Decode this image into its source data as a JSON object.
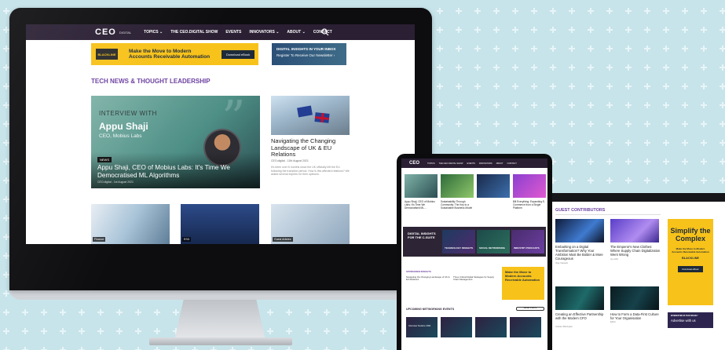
{
  "colors": {
    "background": "#c7e4ea",
    "nav_bg": "#2a1f33",
    "accent_purple": "#6b3fa0",
    "ad_yellow": "#f7c21a"
  },
  "desktop": {
    "nav": {
      "logo": "CEO",
      "logo_tag": "DIGITAL",
      "items": [
        "TOPICS ⌄",
        "THE CEO.DIGITAL SHOW",
        "EVENTS",
        "INNOVATORS ⌄",
        "ABOUT ⌄",
        "CONTACT"
      ],
      "search_icon": "search-icon"
    },
    "banner_blackline": {
      "logo": "BLACKLINE",
      "text": "Make the Move to Modern Accounts Receivable Automation",
      "button": "Download eBook"
    },
    "banner_digital": {
      "line1": "DIGITAL INSIGHTS IN YOUR INBOX",
      "line2": "Register To Receive Our Newsletter ›"
    },
    "section_title": "TECH NEWS & THOUGHT LEADERSHIP",
    "feature": {
      "kicker": "INTERVIEW WITH",
      "name": "Appu Shaji",
      "role": "CEO, Mobius Labs",
      "tag": "NEWS",
      "title": "Appu Shaji, CEO of Mobius Labs: It's Time We Democratised ML Algorithms",
      "meta": "CEO.digital - 1st August 2021"
    },
    "side_article": {
      "title": "Navigating the Changing Landscape of UK & EU Relations",
      "meta": "CEO.digital - 11th August 2021",
      "excerpt": "It's been over 6 months since the UK officially left the EU following the transition period. How is this affected relations? We asked several experts for their opinions."
    },
    "bottom_tags": [
      "Finance",
      "ESG",
      "Guest Articles"
    ]
  },
  "tablet": {
    "nav": {
      "logo": "CEO",
      "items": [
        "TOPICS",
        "THE CEO.DIGITAL SHOW",
        "EVENTS",
        "INNOVATORS",
        "ABOUT",
        "CONTACT"
      ]
    },
    "cards": [
      "Appu Shaji, CEO of Mobius Labs: It's Time We Democratised ML...",
      "Sustainability Through Community: The Key to a Sustainable Business Model",
      "",
      "Bill Everything: Expanding E-Commerce from a Single Platform"
    ],
    "band": {
      "title": "DIGITAL INSIGHTS FOR THE C-SUITE",
      "tiles": [
        "TECHNOLOGY INSIGHTS",
        "SOCIAL NETWORKING",
        "INDUSTRY PODCASTS"
      ]
    },
    "sponsored_label": "SPONSORED INSIGHTS",
    "sponsored_items": [
      "Navigating the Changing Landscape of UK & EU Relations",
      "Three Critical Digital Strategies for Supply Chain Management"
    ],
    "ad_text": "Make the Move to Modern Accounts Receivable Automation",
    "events_title": "UPCOMING NETWORKING EVENTS",
    "events_button": "SEE ALL EVENTS",
    "event_cards": [
      "Interview Feature 2021",
      "",
      "",
      ""
    ]
  },
  "laptop": {
    "section_title": "GUEST CONTRIBUTORS",
    "articles": [
      {
        "title": "Embarking on a Digital Transformation? Why Your Ambition Must Be Bolder & More Courageous",
        "meta": "Vijay Vaswani"
      },
      {
        "title": "The Emperor's New Clothes: Where Supply Chain Digitalization Went Wrong",
        "meta": "Ayo Abiri"
      },
      {
        "title": "Creating an Effective Partnership with the Modern CFO",
        "meta": "Graham Barrington"
      },
      {
        "title": "How to Form a Data-First Culture for Your Organisation",
        "meta": "Editor"
      }
    ],
    "ad": {
      "headline": "Simplify the Complex",
      "sub": "Make the Move to Modern Accounts Receivable Automation",
      "logo": "BLACKLINE",
      "button": "Download eBook"
    },
    "advertise": {
      "line1": "INTERESTED IN THIS SPACE?",
      "line2": "Advertise with us"
    }
  }
}
